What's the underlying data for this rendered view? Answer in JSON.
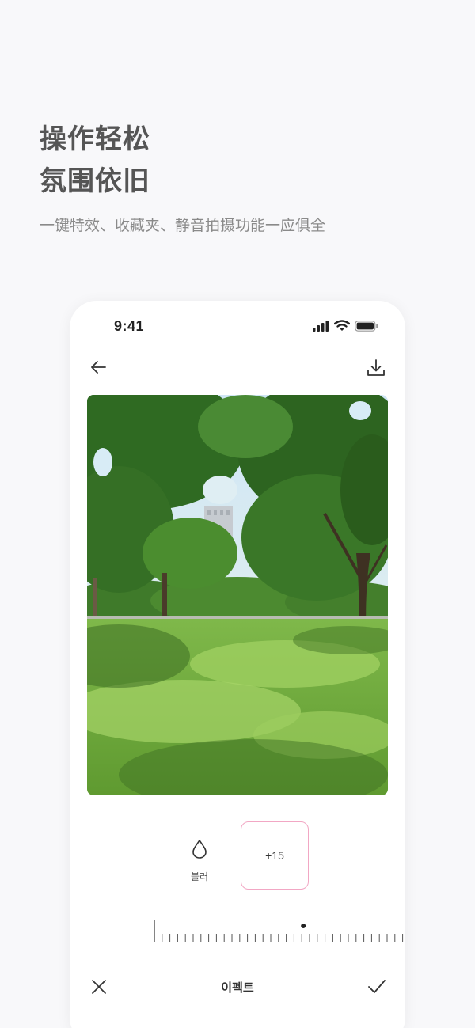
{
  "promo": {
    "headline_line1": "操作轻松",
    "headline_line2": "氛围依旧",
    "subline": "一键特效、收藏夹、静音拍摄功能一应俱全"
  },
  "status_bar": {
    "time": "9:41",
    "icons": [
      "signal-icon",
      "wifi-icon",
      "battery-icon"
    ]
  },
  "top_bar": {
    "icons": [
      "back-arrow-icon",
      "download-icon"
    ]
  },
  "photo": {
    "subject": "park-lawn-trees"
  },
  "effect": {
    "icon": "droplet-icon",
    "label": "블러",
    "value": "+15",
    "slider_level_percent": 60
  },
  "bottom_bar": {
    "title": "이펙트",
    "icons": [
      "close-icon",
      "check-icon"
    ]
  },
  "colors": {
    "accent_border": "#f2a7c4",
    "headline": "#555555",
    "subline": "#8a8a8a"
  }
}
